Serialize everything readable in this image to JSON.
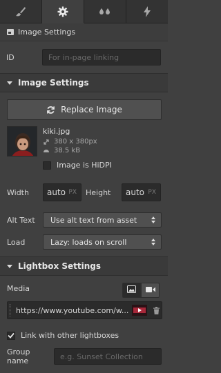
{
  "tabs": [
    {
      "icon": "brush-icon",
      "active": false
    },
    {
      "icon": "gear-icon",
      "active": true
    },
    {
      "icon": "drops-icon",
      "active": false
    },
    {
      "icon": "lightning-icon",
      "active": false
    }
  ],
  "element_bar": {
    "label": "Image Settings"
  },
  "id_field": {
    "label": "ID",
    "placeholder": "For in-page linking"
  },
  "image_settings": {
    "header": "Image Settings",
    "replace_button": "Replace Image",
    "file_name": "kiki.jpg",
    "dimensions": "380 x 380px",
    "file_size": "38.5 kB",
    "hidpi_label": "Image is HiDPI",
    "hidpi_checked": false,
    "width_label": "Width",
    "width_value": "auto",
    "width_unit": "PX",
    "height_label": "Height",
    "height_value": "auto",
    "height_unit": "PX",
    "alt_label": "Alt Text",
    "alt_value": "Use alt text from asset",
    "load_label": "Load",
    "load_value": "Lazy: loads on scroll"
  },
  "lightbox": {
    "header": "Lightbox Settings",
    "media_label": "Media",
    "media_url": "https://www.youtube.com/w...",
    "link_label": "Link with other lightboxes",
    "link_checked": true,
    "group_label": "Group name",
    "group_placeholder": "e.g. Sunset Collection"
  },
  "colors": {
    "panel_bg": "#404040",
    "input_bg": "#2b2b2b",
    "button_bg": "#505050",
    "tab_bg": "#333333"
  }
}
